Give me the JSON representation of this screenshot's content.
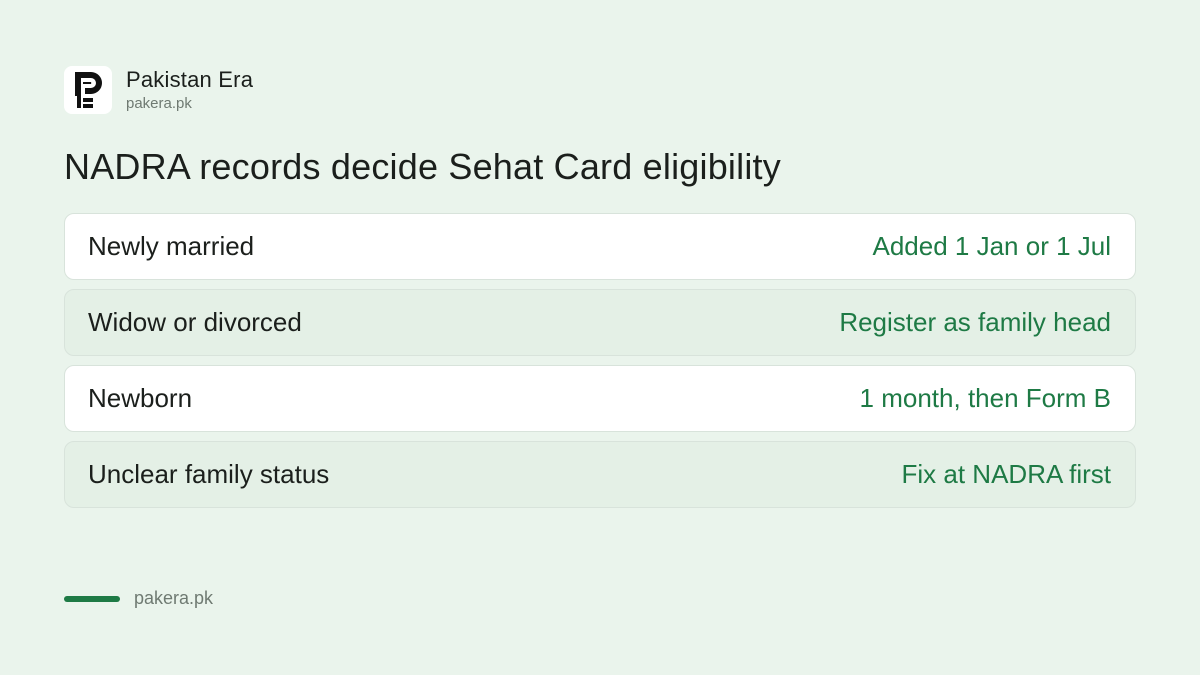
{
  "brand": {
    "name": "Pakistan Era",
    "url": "pakera.pk",
    "logo_icon": "pakistan-era-logo"
  },
  "headline": "NADRA records decide Sehat Card eligibility",
  "rows": [
    {
      "label": "Newly married",
      "value": "Added 1 Jan or 1 Jul"
    },
    {
      "label": "Widow or divorced",
      "value": "Register as family head"
    },
    {
      "label": "Newborn",
      "value": "1 month, then Form B"
    },
    {
      "label": "Unclear family status",
      "value": "Fix at NADRA first"
    }
  ],
  "footer": {
    "url": "pakera.pk"
  },
  "colors": {
    "background": "#eaf4ec",
    "accent": "#1e7a45",
    "text": "#1b1f1c",
    "muted": "#6f7a72"
  }
}
